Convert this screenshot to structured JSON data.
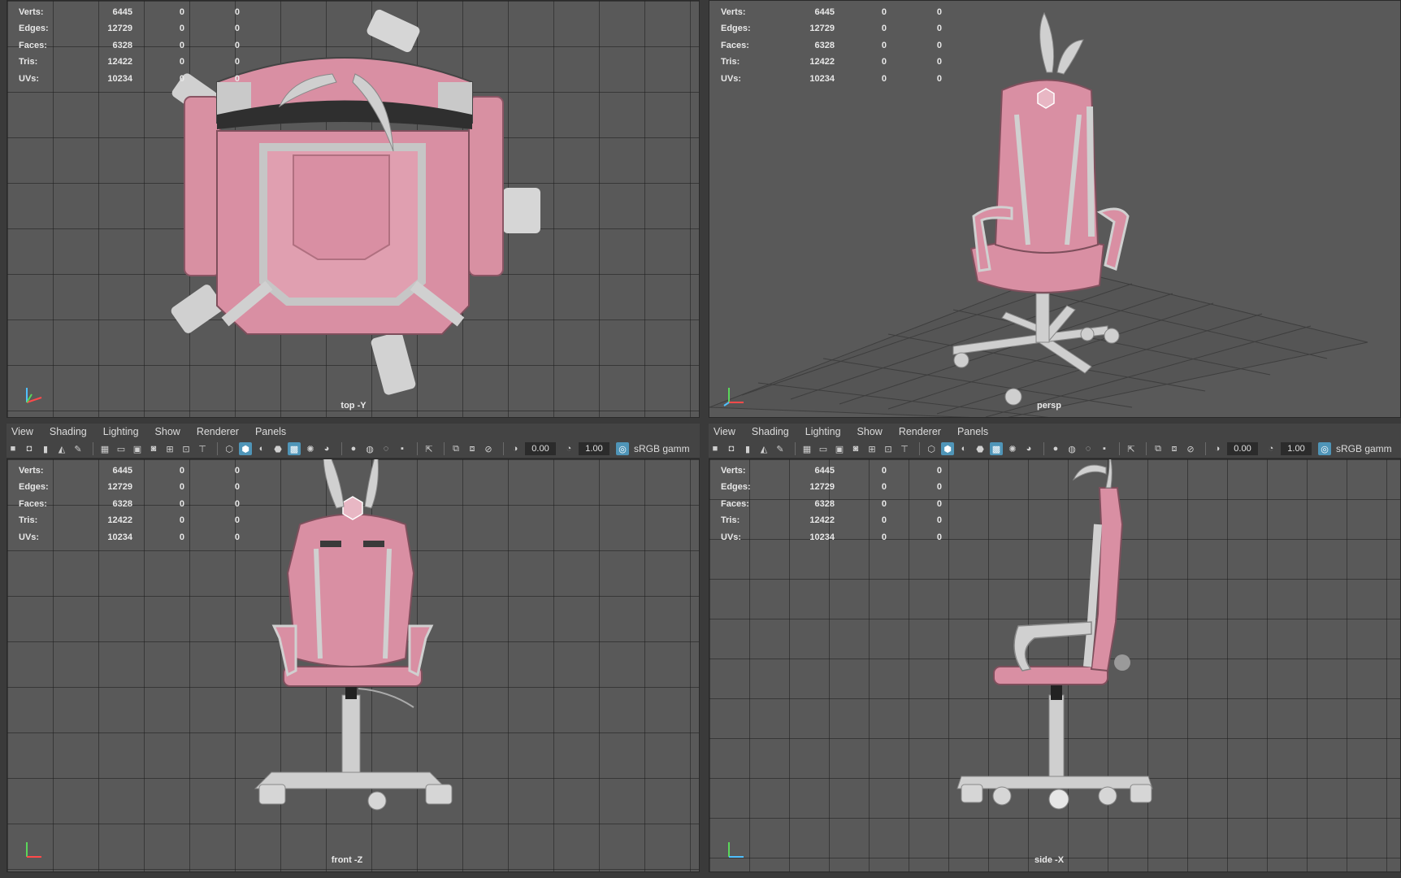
{
  "stats": {
    "rows": [
      {
        "label": "Verts:",
        "v1": "6445",
        "v2": "0",
        "v3": "0"
      },
      {
        "label": "Edges:",
        "v1": "12729",
        "v2": "0",
        "v3": "0"
      },
      {
        "label": "Faces:",
        "v1": "6328",
        "v2": "0",
        "v3": "0"
      },
      {
        "label": "Tris:",
        "v1": "12422",
        "v2": "0",
        "v3": "0"
      },
      {
        "label": "UVs:",
        "v1": "10234",
        "v2": "0",
        "v3": "0"
      }
    ]
  },
  "viewports": {
    "top": {
      "label": "top -Y"
    },
    "persp": {
      "label": "persp"
    },
    "front": {
      "label": "front -Z"
    },
    "side": {
      "label": "side -X"
    }
  },
  "menu": {
    "items": [
      "View",
      "Shading",
      "Lighting",
      "Show",
      "Renderer",
      "Panels"
    ]
  },
  "toolbar": {
    "field1": "0.00",
    "field2": "1.00",
    "color_space": "sRGB gamm"
  },
  "colors": {
    "chair_pink": "#d98fa3",
    "chair_white": "#cfcfcf",
    "viewport_bg": "#595959",
    "highlight": "#4f95b8"
  }
}
